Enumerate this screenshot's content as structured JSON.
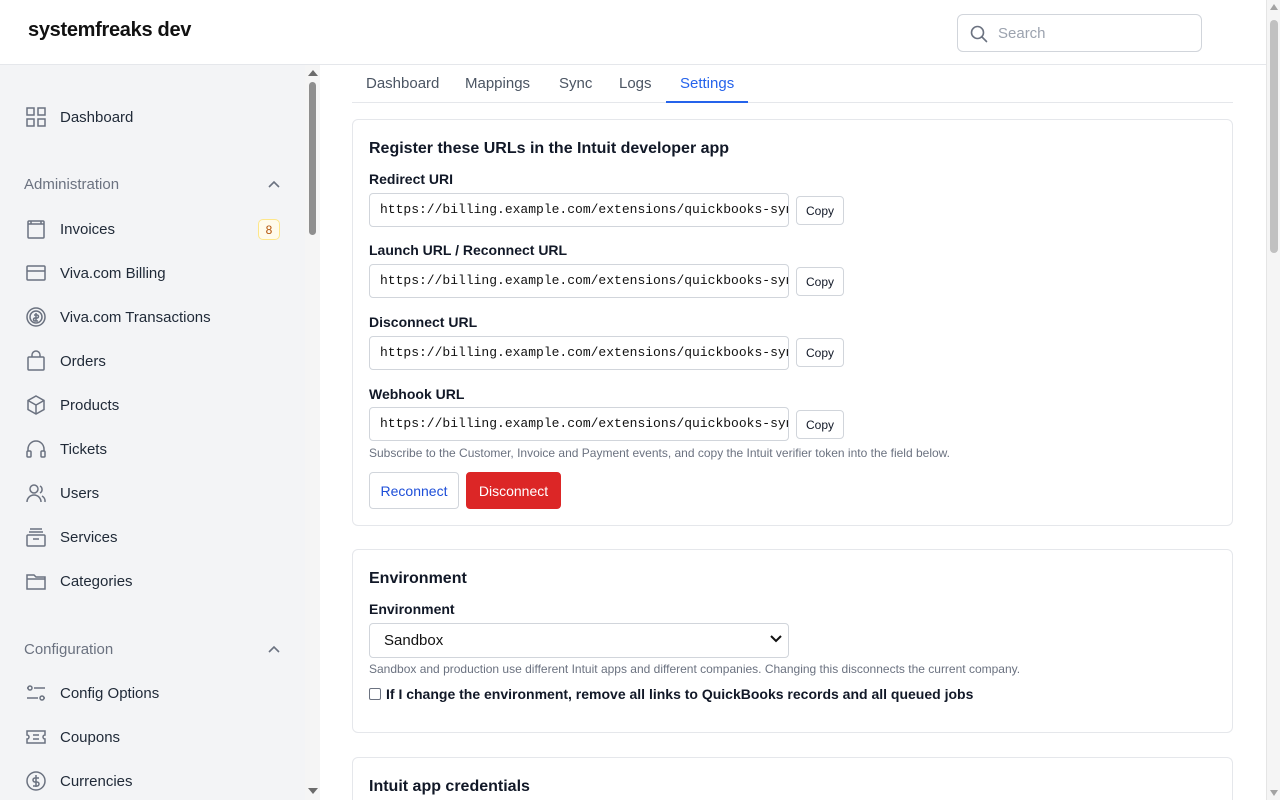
{
  "header": {
    "brand": "systemfreaks dev",
    "search_placeholder": "Search"
  },
  "sidebar": {
    "dashboard": {
      "label": "Dashboard",
      "icon": "grid-icon"
    },
    "administration": {
      "label": "Administration",
      "items": [
        {
          "label": "Invoices",
          "icon": "invoice-icon",
          "badge": "8"
        },
        {
          "label": "Viva.com Billing",
          "icon": "card-icon"
        },
        {
          "label": "Viva.com Transactions",
          "icon": "coin-icon"
        },
        {
          "label": "Orders",
          "icon": "bag-icon"
        },
        {
          "label": "Products",
          "icon": "box-icon"
        },
        {
          "label": "Tickets",
          "icon": "headset-icon"
        },
        {
          "label": "Users",
          "icon": "users-icon"
        },
        {
          "label": "Services",
          "icon": "server-icon"
        },
        {
          "label": "Categories",
          "icon": "folder-icon"
        }
      ]
    },
    "configuration": {
      "label": "Configuration",
      "items": [
        {
          "label": "Config Options",
          "icon": "sliders-icon"
        },
        {
          "label": "Coupons",
          "icon": "ticket-icon"
        },
        {
          "label": "Currencies",
          "icon": "currency-icon"
        }
      ]
    }
  },
  "tabs": [
    {
      "label": "Dashboard",
      "active": false
    },
    {
      "label": "Mappings",
      "active": false
    },
    {
      "label": "Sync",
      "active": false
    },
    {
      "label": "Logs",
      "active": false
    },
    {
      "label": "Settings",
      "active": true
    }
  ],
  "urls_card": {
    "title": "Register these URLs in the Intuit developer app",
    "fields": [
      {
        "label": "Redirect URI",
        "value": "https://billing.example.com/extensions/quickbooks-sync/callback",
        "copy": "Copy"
      },
      {
        "label": "Launch URL / Reconnect URL",
        "value": "https://billing.example.com/extensions/quickbooks-sync/connect",
        "copy": "Copy"
      },
      {
        "label": "Disconnect URL",
        "value": "https://billing.example.com/extensions/quickbooks-sync/disconnect",
        "copy": "Copy"
      },
      {
        "label": "Webhook URL",
        "value": "https://billing.example.com/extensions/quickbooks-sync/webhook",
        "copy": "Copy"
      }
    ],
    "help": "Subscribe to the Customer, Invoice and Payment events, and copy the Intuit verifier token into the field below.",
    "reconnect": "Reconnect",
    "disconnect": "Disconnect"
  },
  "environment_card": {
    "title": "Environment",
    "field_label": "Environment",
    "selected": "Sandbox",
    "help": "Sandbox and production use different Intuit apps and different companies. Changing this disconnects the current company.",
    "checkbox_label": "If I change the environment, remove all links to QuickBooks records and all queued jobs",
    "checked": false
  },
  "credentials_card": {
    "title": "Intuit app credentials"
  },
  "colors": {
    "accent": "#2563eb",
    "danger": "#dc2626",
    "sidebar_bg": "#f3f4f6",
    "badge_text": "#b45309"
  }
}
